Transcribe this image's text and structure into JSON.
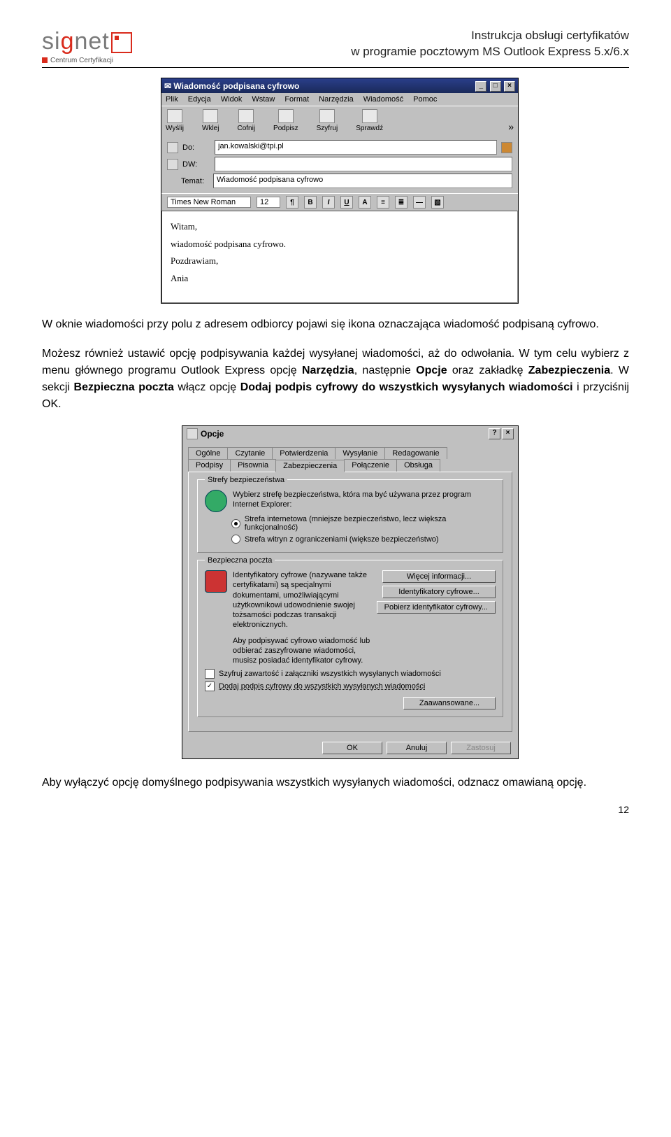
{
  "header": {
    "logo_text_a": "si",
    "logo_text_b": "g",
    "logo_text_c": "net",
    "logo_sub": "Centrum Certyfikacji",
    "right_line1": "Instrukcja obsługi certyfikatów",
    "right_line2": "w programie pocztowym MS Outlook Express 5.x/6.x"
  },
  "compose": {
    "title": "Wiadomość podpisana cyfrowo",
    "menu": [
      "Plik",
      "Edycja",
      "Widok",
      "Wstaw",
      "Format",
      "Narzędzia",
      "Wiadomość",
      "Pomoc"
    ],
    "toolbar": [
      "Wyślij",
      "Wklej",
      "Cofnij",
      "Podpisz",
      "Szyfruj",
      "Sprawdź"
    ],
    "labels": {
      "to": "Do:",
      "cc": "DW:",
      "subject": "Temat:"
    },
    "to_value": "jan.kowalski@tpi.pl",
    "cc_value": "",
    "subject_value": "Wiadomość podpisana cyfrowo",
    "font_name": "Times New Roman",
    "font_size": "12",
    "body_lines": [
      "Witam,",
      "wiadomość podpisana cyfrowo.",
      "Pozdrawiam,",
      "Ania"
    ]
  },
  "para1": "W oknie wiadomości przy polu z adresem odbiorcy pojawi się ikona oznaczająca wiadomość podpisaną cyfrowo.",
  "para2a": "Możesz również ustawić opcję podpisywania każdej wysyłanej wiadomości, aż do odwołania. W tym celu wybierz z menu głównego programu Outlook Express opcję ",
  "para2b": "Narzędzia",
  "para2c": ", następnie ",
  "para2d": "Opcje",
  "para2e": " oraz zakładkę ",
  "para2f": "Zabezpieczenia",
  "para2g": ". W sekcji ",
  "para2h": "Bezpieczna poczta",
  "para2i": " włącz opcję ",
  "para2j": "Dodaj podpis cyfrowy do wszystkich wysyłanych wiadomości",
  "para2k": " i przyciśnij OK.",
  "options": {
    "title": "Opcje",
    "tabs_row1": [
      "Ogólne",
      "Czytanie",
      "Potwierdzenia",
      "Wysyłanie",
      "Redagowanie"
    ],
    "tabs_row2": [
      "Podpisy",
      "Pisownia",
      "Zabezpieczenia",
      "Połączenie",
      "Obsługa"
    ],
    "active_tab": "Zabezpieczenia",
    "group1_title": "Strefy bezpieczeństwa",
    "group1_text": "Wybierz strefę bezpieczeństwa, która ma być używana przez program Internet Explorer:",
    "radio1": "Strefa internetowa (mniejsze bezpieczeństwo, lecz większa funkcjonalność)",
    "radio2": "Strefa witryn z ograniczeniami (większe bezpieczeństwo)",
    "group2_title": "Bezpieczna poczta",
    "group2_text1": "Identyfikatory cyfrowe (nazywane także certyfikatami) są specjalnymi dokumentami, umożliwiającymi użytkownikowi udowodnienie swojej tożsamości podczas transakcji elektronicznych.",
    "group2_text2": "Aby podpisywać cyfrowo wiadomość lub odbierać zaszyfrowane wiadomości, musisz posiadać identyfikator cyfrowy.",
    "btn_more": "Więcej informacji...",
    "btn_ids": "Identyfikatory cyfrowe...",
    "btn_get": "Pobierz identyfikator cyfrowy...",
    "chk1": "Szyfruj zawartość i załączniki wszystkich wysyłanych wiadomości",
    "chk2": "Dodaj podpis cyfrowy do wszystkich wysyłanych wiadomości",
    "btn_adv": "Zaawansowane...",
    "btn_ok": "OK",
    "btn_cancel": "Anuluj",
    "btn_apply": "Zastosuj"
  },
  "para3": "Aby wyłączyć opcję domyślnego podpisywania wszystkich wysyłanych wiadomości, odznacz omawianą opcję.",
  "page_number": "12"
}
